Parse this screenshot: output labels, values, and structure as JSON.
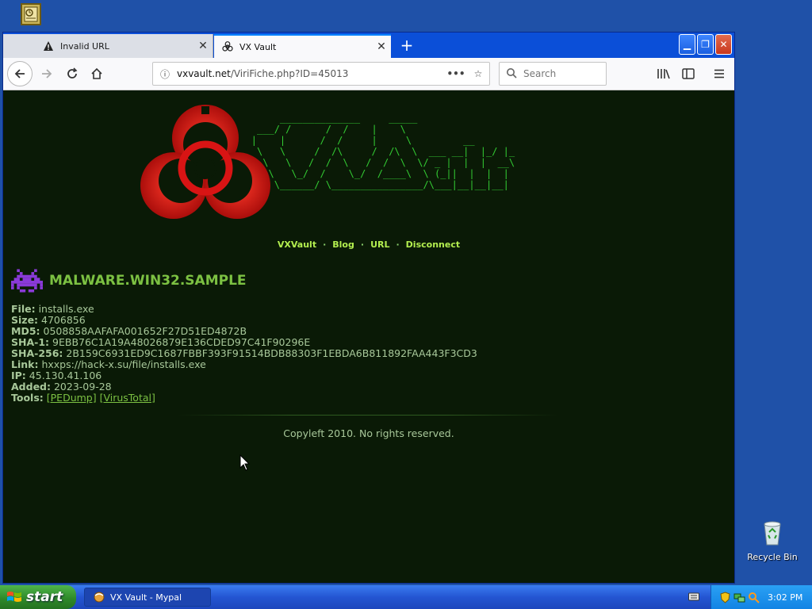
{
  "desktop": {
    "recycle_bin_label": "Recycle Bin"
  },
  "browser": {
    "tabs": [
      {
        "label": "Invalid URL",
        "icon": "warning-icon",
        "active": false
      },
      {
        "label": "VX Vault",
        "icon": "biohazard-icon",
        "active": true
      }
    ],
    "url_domain": "vxvault.net",
    "url_path": "/ViriFiche.php?ID=45013",
    "search_placeholder": "Search"
  },
  "page": {
    "nav": [
      "VXVault",
      "Blog",
      "URL",
      "Disconnect"
    ],
    "title": "MALWARE.WIN32.SAMPLE",
    "details": [
      {
        "label": "File:",
        "value": "installs.exe"
      },
      {
        "label": "Size:",
        "value": "4706856"
      },
      {
        "label": "MD5:",
        "value": "0508858AAFAFA001652F27D51ED4872B"
      },
      {
        "label": "SHA-1:",
        "value": "9EBB76C1A19A48026879E136CDED97C41F90296E"
      },
      {
        "label": "SHA-256:",
        "value": "2B159C6931ED9C1687FBBF393F91514BDB88303F1EBDA6B811892FAA443F3CD3"
      },
      {
        "label": "Link:",
        "value": "hxxps://hack-x.su/file/installs.exe"
      },
      {
        "label": "IP:",
        "value": "45.130.41.106"
      },
      {
        "label": "Added:",
        "value": "2023-09-28"
      }
    ],
    "tools_label": "Tools:",
    "tools": [
      "[PEDump]",
      "[VirusTotal]"
    ],
    "footer": "Copyleft 2010. No rights reserved."
  },
  "taskbar": {
    "start_label": "start",
    "task_label": "VX Vault - Mypal",
    "clock": "3:02 PM"
  },
  "colors": {
    "page_bg": "#0a1a06",
    "accent_green": "#7cc142",
    "link_green": "#b3ee4f",
    "biohazard_red": "#e01010"
  }
}
